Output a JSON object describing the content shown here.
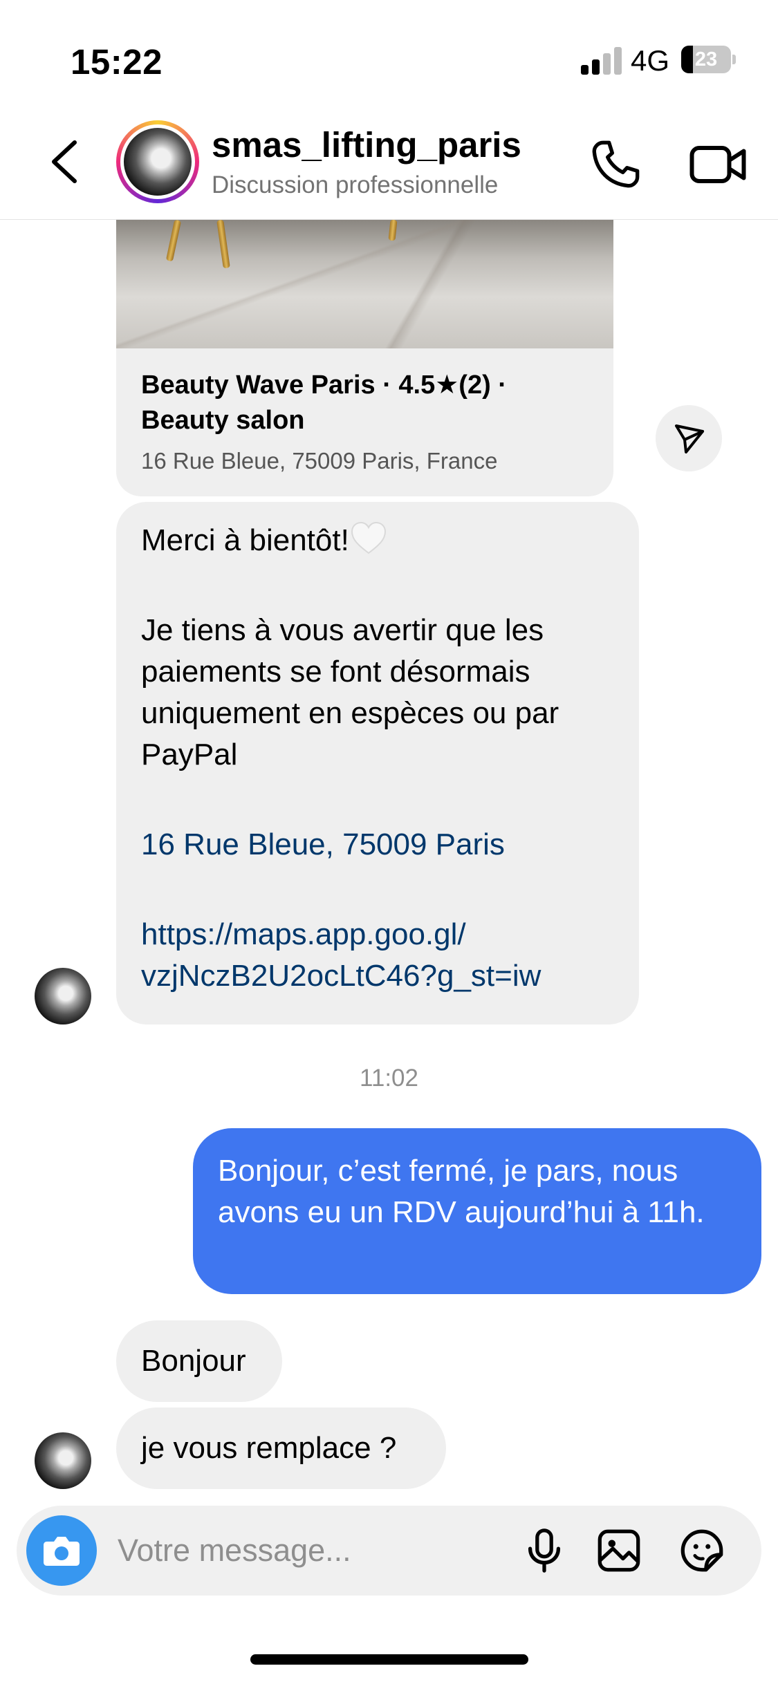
{
  "status_bar": {
    "time": "15:22",
    "network": "4G",
    "battery": "23",
    "battery_level": 0.23
  },
  "header": {
    "name": "smas_lifting_paris",
    "subtitle": "Discussion professionnelle",
    "back_icon": "chevron-left-icon",
    "call_icon": "phone-icon",
    "video_icon": "video-camera-icon"
  },
  "location_card": {
    "title": "Beauty Wave Paris · 4.5★(2) · Beauty salon",
    "address": "16 Rue Bleue, 75009 Paris, France",
    "share_icon": "send-icon"
  },
  "messages": {
    "incoming_1": {
      "line1": "Merci à bientôt!",
      "heart_icon": "white-heart-icon",
      "paragraph": "Je tiens à vous avertir que les paiements se font désormais uniquement en espèces ou par PayPal",
      "address_link": "16 Rue Bleue, 75009 Paris",
      "url_link_1": "https://maps.app.goo.gl/",
      "url_link_2": "vzjNczB2U2ocLtC46?g_st=iw"
    },
    "time_separator": "11:02",
    "outgoing_1": "Bonjour, c’est fermé, je pars, nous avons eu un RDV aujourd’hui à 11h.",
    "incoming_2": "Bonjour",
    "incoming_3": "je vous remplace ?"
  },
  "composer": {
    "placeholder": "Votre message...",
    "camera_icon": "camera-icon",
    "mic_icon": "microphone-icon",
    "gallery_icon": "image-icon",
    "sticker_icon": "sticker-icon"
  },
  "colors": {
    "outgoing_bubble": "#3f76f0",
    "incoming_bubble": "#efefef",
    "link": "#00376b",
    "camera_button": "#3797f0"
  }
}
